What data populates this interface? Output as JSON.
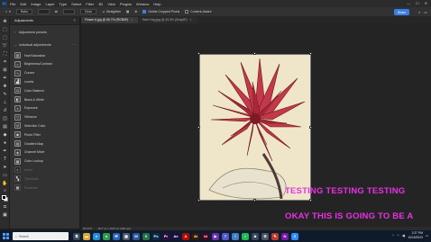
{
  "menubar": {
    "logo": "Ps",
    "items": [
      "File",
      "Edit",
      "Image",
      "Layer",
      "Type",
      "Select",
      "Filter",
      "3D",
      "View",
      "Plugins",
      "Window",
      "Help"
    ],
    "window_controls": [
      "—",
      "☐",
      "✕"
    ]
  },
  "options": {
    "ratio": "Ratio",
    "clear": "Clear",
    "straighten": "Straighten",
    "delete_cropped": "Delete Cropped Pixels",
    "content_aware": "Content-Aware",
    "share": "Share"
  },
  "adjustments": {
    "tab_title": "Adjustments",
    "presets_label": "Adjustment presets",
    "individual_label": "Individual adjustments",
    "items": [
      {
        "label": "Hue/Saturation",
        "icon": "▥",
        "dim": false
      },
      {
        "label": "Brightness/Contrast",
        "icon": "☼",
        "dim": false
      },
      {
        "label": "Curves",
        "icon": "∿",
        "dim": false
      },
      {
        "label": "Levels",
        "icon": "▟",
        "dim": false
      },
      {
        "label": "Color Balance",
        "icon": "⚖",
        "dim": false
      },
      {
        "label": "Black & White",
        "icon": "◧",
        "dim": false
      },
      {
        "label": "Exposure",
        "icon": "±",
        "dim": false
      },
      {
        "label": "Vibrance",
        "icon": "▽",
        "dim": false
      },
      {
        "label": "Selective Color",
        "icon": "◎",
        "dim": false
      },
      {
        "label": "Photo Filter",
        "icon": "◉",
        "dim": false
      },
      {
        "label": "Gradient Map",
        "icon": "▤",
        "dim": false
      },
      {
        "label": "Channel Mixer",
        "icon": "◈",
        "dim": false
      },
      {
        "label": "Color Lookup",
        "icon": "▦",
        "dim": false
      },
      {
        "label": "Invert",
        "icon": "◐",
        "dim": true
      },
      {
        "label": "Threshold",
        "icon": "▚",
        "dim": true
      },
      {
        "label": "Posterize",
        "icon": "▩",
        "dim": true
      }
    ]
  },
  "doc_tabs": [
    {
      "label": "Flower A.jpg @ 66.7% (RGB/8*)",
      "active": true
    },
    {
      "label": "Beer Keg.jpg @ 33.3% (Gray/8*)",
      "active": false
    }
  ],
  "canvas": {
    "overlay_line_1": "TESTING TESTING TESTING",
    "overlay_line_2": "OKAY THIS IS GOING TO BE A"
  },
  "statusbar": {
    "zoom": "66.67%",
    "doc_size": "1117 px x 1514 px (300 ppi)"
  },
  "taskbar": {
    "search_placeholder": "Search",
    "apps": [
      {
        "name": "task-view",
        "glyph": "⧉",
        "color": "#3a4658"
      },
      {
        "name": "explorer",
        "glyph": "▬",
        "color": "#d8a63a"
      },
      {
        "name": "edge",
        "glyph": "e",
        "color": "#1f8fd9"
      },
      {
        "name": "chrome",
        "glyph": "●",
        "color": "#2e9c4f"
      },
      {
        "name": "mail",
        "glyph": "✉",
        "color": "#2763b8"
      },
      {
        "name": "store",
        "glyph": "▦",
        "color": "#4a5a73"
      },
      {
        "name": "word",
        "glyph": "W",
        "color": "#2b579a"
      },
      {
        "name": "excel",
        "glyph": "X",
        "color": "#217346"
      },
      {
        "name": "photoshop",
        "glyph": "Ps",
        "color": "#0d2b4d"
      },
      {
        "name": "premiere",
        "glyph": "Pr",
        "color": "#2a0f45"
      },
      {
        "name": "after-effects",
        "glyph": "Ae",
        "color": "#1d0d45"
      },
      {
        "name": "acrobat",
        "glyph": "A",
        "color": "#b30b00"
      },
      {
        "name": "illustrator",
        "glyph": "Ai",
        "color": "#3a1b00"
      },
      {
        "name": "indesign",
        "glyph": "Id",
        "color": "#49021f"
      },
      {
        "name": "media",
        "glyph": "▶",
        "color": "#6b2fb3"
      },
      {
        "name": "teams",
        "glyph": "T",
        "color": "#5059c9"
      },
      {
        "name": "notepad",
        "glyph": "≡",
        "color": "#3f7fc4"
      },
      {
        "name": "spotify",
        "glyph": "♫",
        "color": "#1db954"
      },
      {
        "name": "camera",
        "glyph": "◙",
        "color": "#37475c"
      },
      {
        "name": "settings",
        "glyph": "⚙",
        "color": "#4b5563"
      },
      {
        "name": "paint",
        "glyph": "✎",
        "color": "#c0392b"
      },
      {
        "name": "onenote",
        "glyph": "N",
        "color": "#7719aa"
      },
      {
        "name": "zoom",
        "glyph": "Z",
        "color": "#2d8cff"
      }
    ],
    "time": "2:37 PM",
    "date": "10/15/2023"
  },
  "colors": {
    "overlay_text": "#e930e6",
    "share_button": "#3b7fe6",
    "flower_petal": "#c23a4a"
  }
}
